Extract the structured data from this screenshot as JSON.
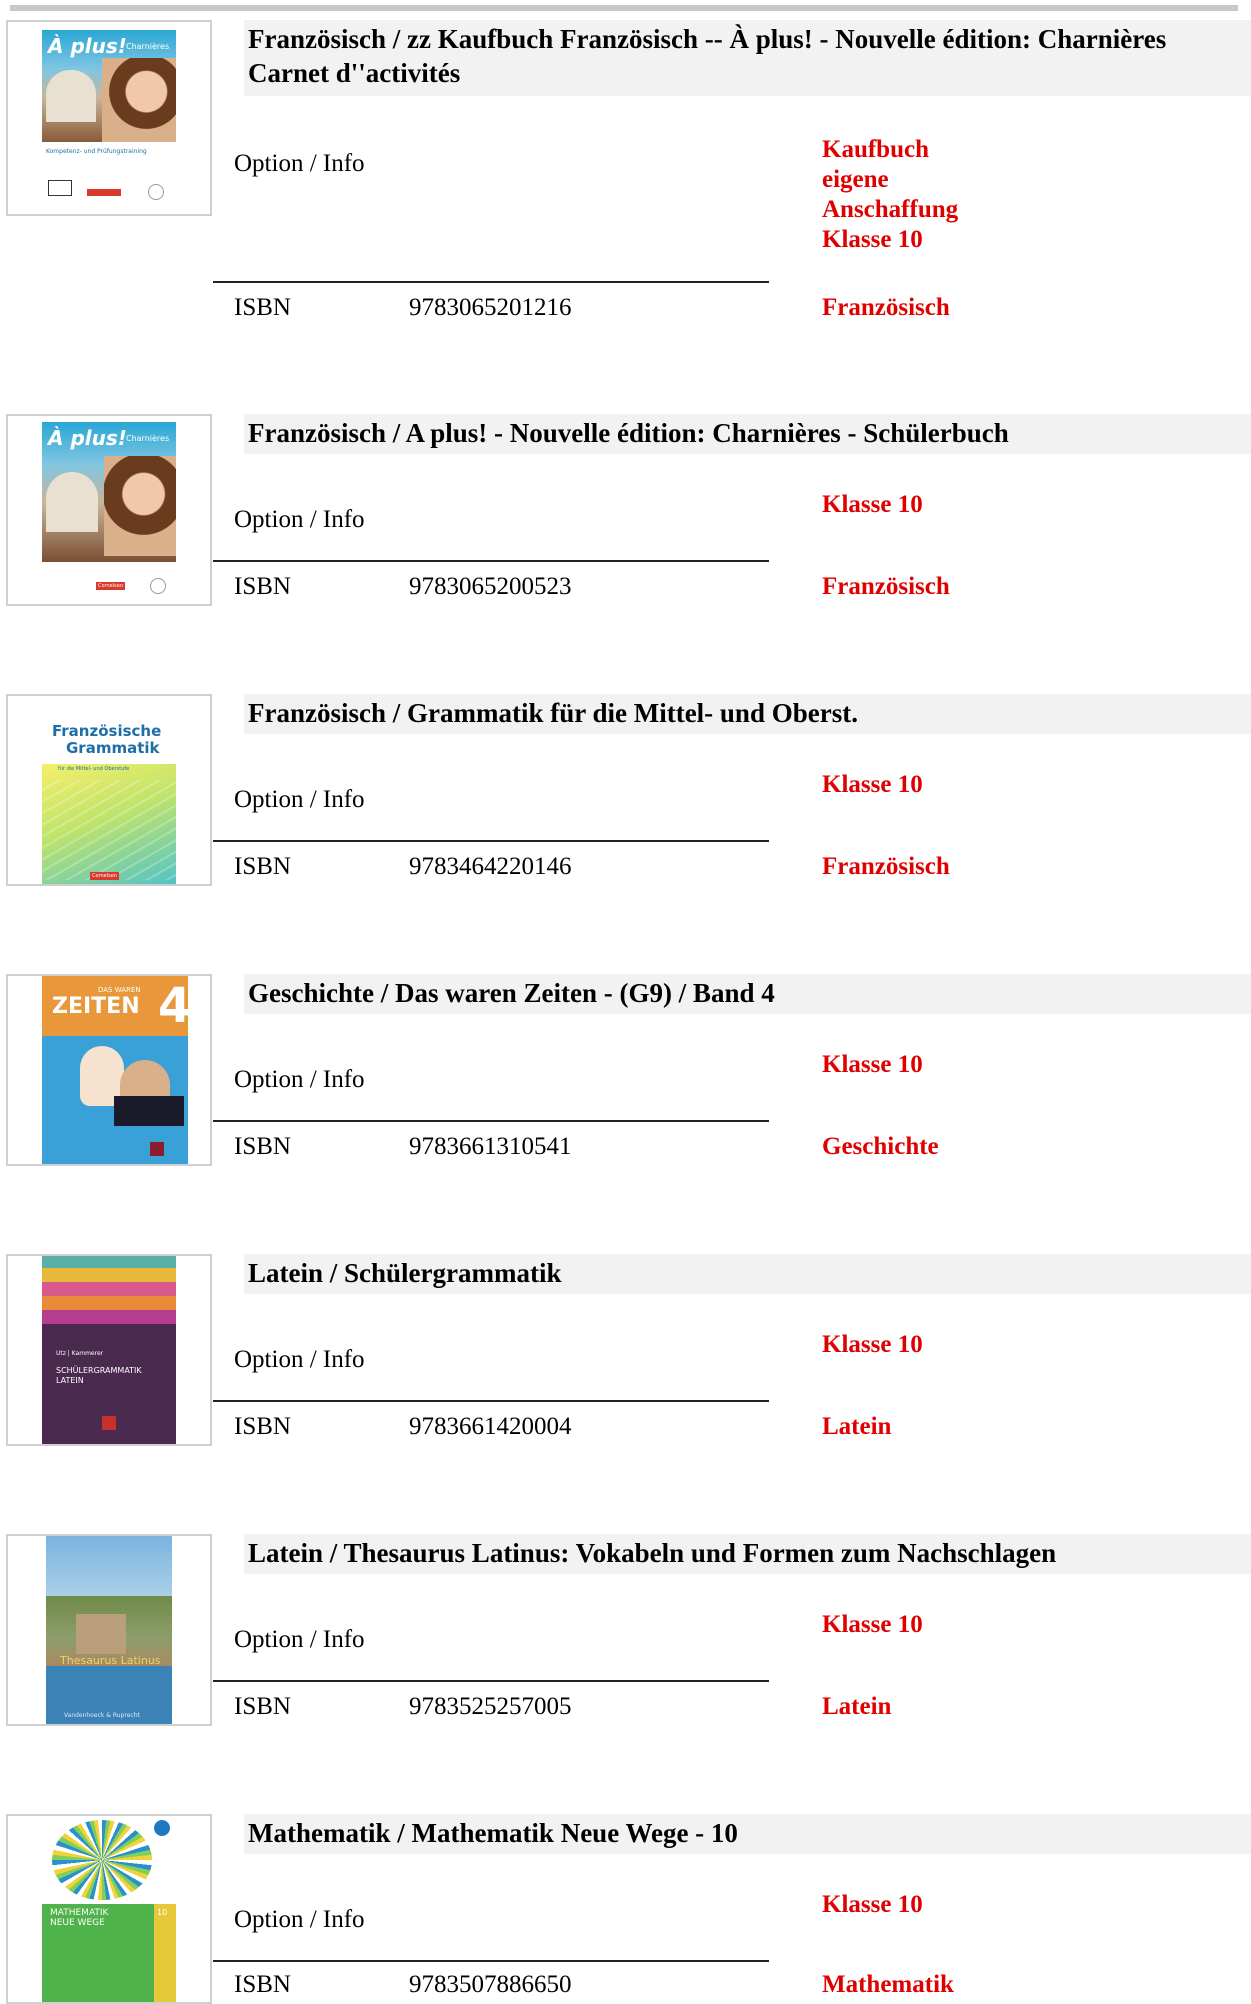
{
  "labels": {
    "option": "Option / Info",
    "isbn": "ISBN"
  },
  "accent_color": "#e00000",
  "books": [
    {
      "title": "Französisch /  zz Kaufbuch Französisch --  À plus! - Nouvelle édition: Charnières Carnet d''activités",
      "notes": [
        "Kaufbuch",
        "eigene",
        "Anschaffung",
        "Klasse 10"
      ],
      "isbn": "9783065201216",
      "subject": "Französisch",
      "cover": {
        "brand": "À plus!",
        "sub": "Charnières",
        "extra": "Kompetenz- und Prüfungstraining",
        "publisher": "Cornelsen"
      }
    },
    {
      "title": "Französisch / A plus! - Nouvelle édition: Charnières - Schülerbuch",
      "notes": [
        "Klasse 10"
      ],
      "isbn": "9783065200523",
      "subject": "Französisch",
      "cover": {
        "brand": "À plus!",
        "sub": "Charnières",
        "publisher": "Cornelsen"
      }
    },
    {
      "title": "Französisch / Grammatik für die Mittel- und Oberst.",
      "notes": [
        "Klasse 10"
      ],
      "isbn": "9783464220146",
      "subject": "Französisch",
      "cover": {
        "line1": "Französische",
        "line2": "Grammatik",
        "line3": "für die Mittel- und Oberstufe",
        "publisher": "Cornelsen"
      }
    },
    {
      "title": "Geschichte / Das waren Zeiten - (G9) / Band 4",
      "notes": [
        "Klasse 10"
      ],
      "isbn": "9783661310541",
      "subject": "Geschichte",
      "cover": {
        "small": "DAS WAREN",
        "big": "ZEITEN",
        "num": "4"
      }
    },
    {
      "title": "Latein / Schülergrammatik",
      "notes": [
        "Klasse 10"
      ],
      "isbn": "9783661420004",
      "subject": "Latein",
      "cover": {
        "author": "Utz | Kammerer",
        "line1": "SCHÜLERGRAMMATIK",
        "line2": "LATEIN"
      }
    },
    {
      "title": "Latein / Thesaurus Latinus: Vokabeln und Formen zum Nachschlagen",
      "notes": [
        "Klasse 10"
      ],
      "isbn": "9783525257005",
      "subject": "Latein",
      "cover": {
        "line1": "Thesaurus Latinus",
        "publisher": "Vandenhoeck & Ruprecht"
      }
    },
    {
      "title": "Mathematik / Mathematik Neue Wege - 10",
      "notes": [
        "Klasse 10"
      ],
      "isbn": "9783507886650",
      "subject": "Mathematik",
      "cover": {
        "line1": "MATHEMATIK",
        "line2": "NEUE WEGE",
        "num": "10"
      }
    }
  ]
}
